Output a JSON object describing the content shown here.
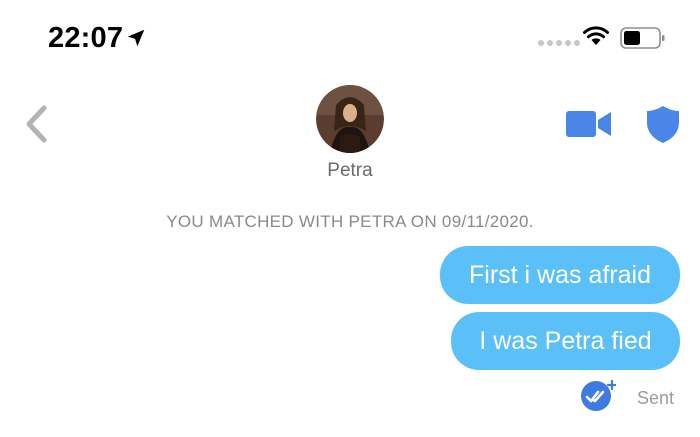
{
  "status_bar": {
    "time": "22:07",
    "icons": [
      "location-arrow-icon",
      "cellular-signal-icon",
      "wifi-icon",
      "battery-icon"
    ]
  },
  "header": {
    "contact_name": "Petra",
    "icons": [
      "back-chevron-icon",
      "avatar",
      "video-call-icon",
      "safety-shield-icon"
    ],
    "accent_color": "#4a86e8"
  },
  "chat": {
    "match_note": "YOU MATCHED WITH PETRA ON 09/11/2020.",
    "messages": [
      {
        "text": "First i was afraid",
        "direction": "outgoing"
      },
      {
        "text": "I was Petra fied",
        "direction": "outgoing"
      }
    ],
    "bubble_color": "#5bc0f8",
    "receipt_status": "Sent"
  }
}
